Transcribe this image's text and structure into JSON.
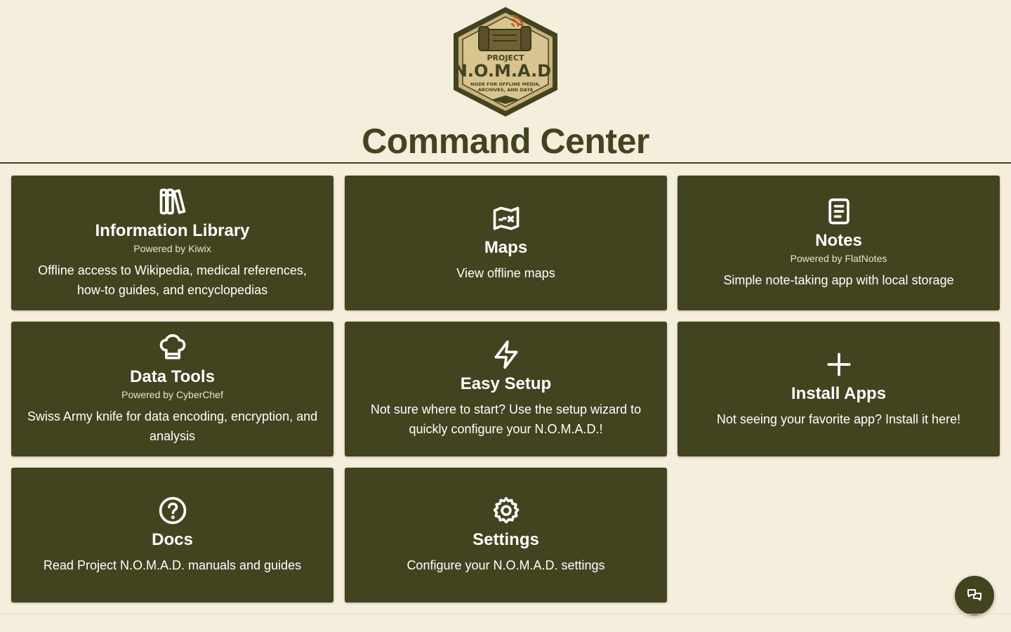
{
  "logo": {
    "line1": "PROJECT",
    "line2": "N.O.M.A.D.",
    "line3": "NODE FOR OFFLINE MEDIA,",
    "line4": "ARCHIVES, AND DATA"
  },
  "page_title": "Command Center",
  "cards": [
    {
      "title": "Information Library",
      "powered": "Powered by Kiwix",
      "desc": "Offline access to Wikipedia, medical references, how-to guides, and encyclopedias",
      "icon": "books-icon"
    },
    {
      "title": "Maps",
      "powered": "",
      "desc": "View offline maps",
      "icon": "map-icon"
    },
    {
      "title": "Notes",
      "powered": "Powered by FlatNotes",
      "desc": "Simple note-taking app with local storage",
      "icon": "note-icon"
    },
    {
      "title": "Data Tools",
      "powered": "Powered by CyberChef",
      "desc": "Swiss Army knife for data encoding, encryption, and analysis",
      "icon": "chef-hat-icon"
    },
    {
      "title": "Easy Setup",
      "powered": "",
      "desc": "Not sure where to start? Use the setup wizard to quickly configure your N.O.M.A.D.!",
      "icon": "bolt-icon"
    },
    {
      "title": "Install Apps",
      "powered": "",
      "desc": "Not seeing your favorite app? Install it here!",
      "icon": "plus-icon"
    },
    {
      "title": "Docs",
      "powered": "",
      "desc": "Read Project N.O.M.A.D. manuals and guides",
      "icon": "help-circle-icon"
    },
    {
      "title": "Settings",
      "powered": "",
      "desc": "Configure your N.O.M.A.D. settings",
      "icon": "gear-icon"
    }
  ],
  "colors": {
    "background": "#f6eedd",
    "card": "#424420",
    "accent": "#c8551f"
  }
}
